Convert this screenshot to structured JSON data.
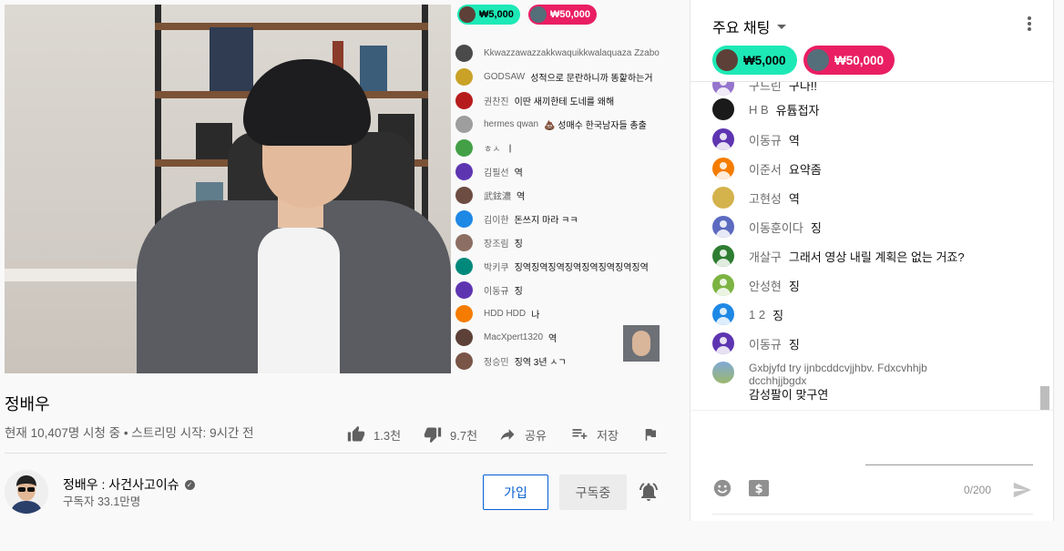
{
  "video": {
    "title": "정배우",
    "view_info": "현재 10,407명 시청 중 • 스트리밍 시작: 9시간 전",
    "like_count": "1.3천",
    "dislike_count": "9.7천",
    "share_label": "공유",
    "save_label": "저장"
  },
  "overlay_chat": {
    "super_chats": [
      {
        "amount": "₩5,000",
        "color": "#1de9b6"
      },
      {
        "amount": "₩50,000",
        "color": "#e91e63"
      }
    ],
    "messages": [
      {
        "author": "Kkwazzawazzakkwaquikkwalaquaza Zzabo",
        "text": "",
        "color": "#4a4a4a"
      },
      {
        "author": "GODSAW",
        "text": "성적으로 문란하니까 똥핥하는거",
        "color": "#c9a227"
      },
      {
        "author": "권찬진",
        "text": "이딴 새끼한테 도네를 왜해",
        "color": "#b71c1c"
      },
      {
        "author": "hermes qwan",
        "text": "💩 성매수 한국남자들 총출",
        "color": "#9e9e9e"
      },
      {
        "author": "ㅎㅅ",
        "text": "ㅣ",
        "color": "#43a047"
      },
      {
        "author": "김필선",
        "text": "역",
        "color": "#5e35b1"
      },
      {
        "author": "武鉉濃",
        "text": "역",
        "color": "#6d4c41"
      },
      {
        "author": "김이한",
        "text": "돈쓰지 마라 ㅋㅋ",
        "color": "#1e88e5"
      },
      {
        "author": "장조림",
        "text": "징",
        "color": "#8d6e63"
      },
      {
        "author": "박키쿠",
        "text": "징역징역징역징역징역징역징역징역",
        "color": "#00897b"
      },
      {
        "author": "이동규",
        "text": "징",
        "color": "#5e35b1"
      },
      {
        "author": "HDD HDD",
        "text": "나",
        "color": "#f57c00"
      },
      {
        "author": "MacXpert1320",
        "text": "역",
        "color": "#5d4037"
      },
      {
        "author": "정승민",
        "text": "징역 3년 ㅅㄱ",
        "color": "#795548"
      }
    ]
  },
  "channel": {
    "name": "정배우 : 사건사고이슈",
    "subscribers": "구독자 33.1만명",
    "join_label": "가입",
    "subscribed_label": "구독중"
  },
  "chat": {
    "mode_label": "주요 채팅",
    "super_chats": [
      {
        "amount": "₩5,000",
        "color": "#1de9b6",
        "avatar_color": "#5d4037"
      },
      {
        "amount": "₩50,000",
        "color": "#e91e63",
        "avatar_color": "#546e7a"
      }
    ],
    "partial_top": {
      "author": "구드린",
      "text": "구다!!"
    },
    "messages": [
      {
        "author": "H B",
        "text": "유튭접자",
        "color": "#1a1a1a"
      },
      {
        "author": "이동규",
        "text": "역",
        "color": "#5e35b1"
      },
      {
        "author": "이준서",
        "text": "요약좀",
        "color": "#f57c00"
      },
      {
        "author": "고현성",
        "text": "역",
        "color": "#d4b24c"
      },
      {
        "author": "이동훈이다",
        "text": "징",
        "color": "#5c6bc0"
      },
      {
        "author": "개살구",
        "text": "그래서 영상 내릴 계획은 없는 거죠?",
        "color": "#2e7d32"
      },
      {
        "author": "안성현",
        "text": "징",
        "color": "#7cb342"
      },
      {
        "author": "1 2",
        "text": "징",
        "color": "#1e88e5"
      },
      {
        "author": "이동규",
        "text": "징",
        "color": "#5e35b1"
      }
    ],
    "last_message": {
      "author_line1": "Gxbjyfd try ijnbcddcvjjhbv. Fdxcvhhjb",
      "author_line2": "dcchhjjbgdx",
      "text": "감성팔이 맞구연"
    },
    "counter": "0/200"
  }
}
